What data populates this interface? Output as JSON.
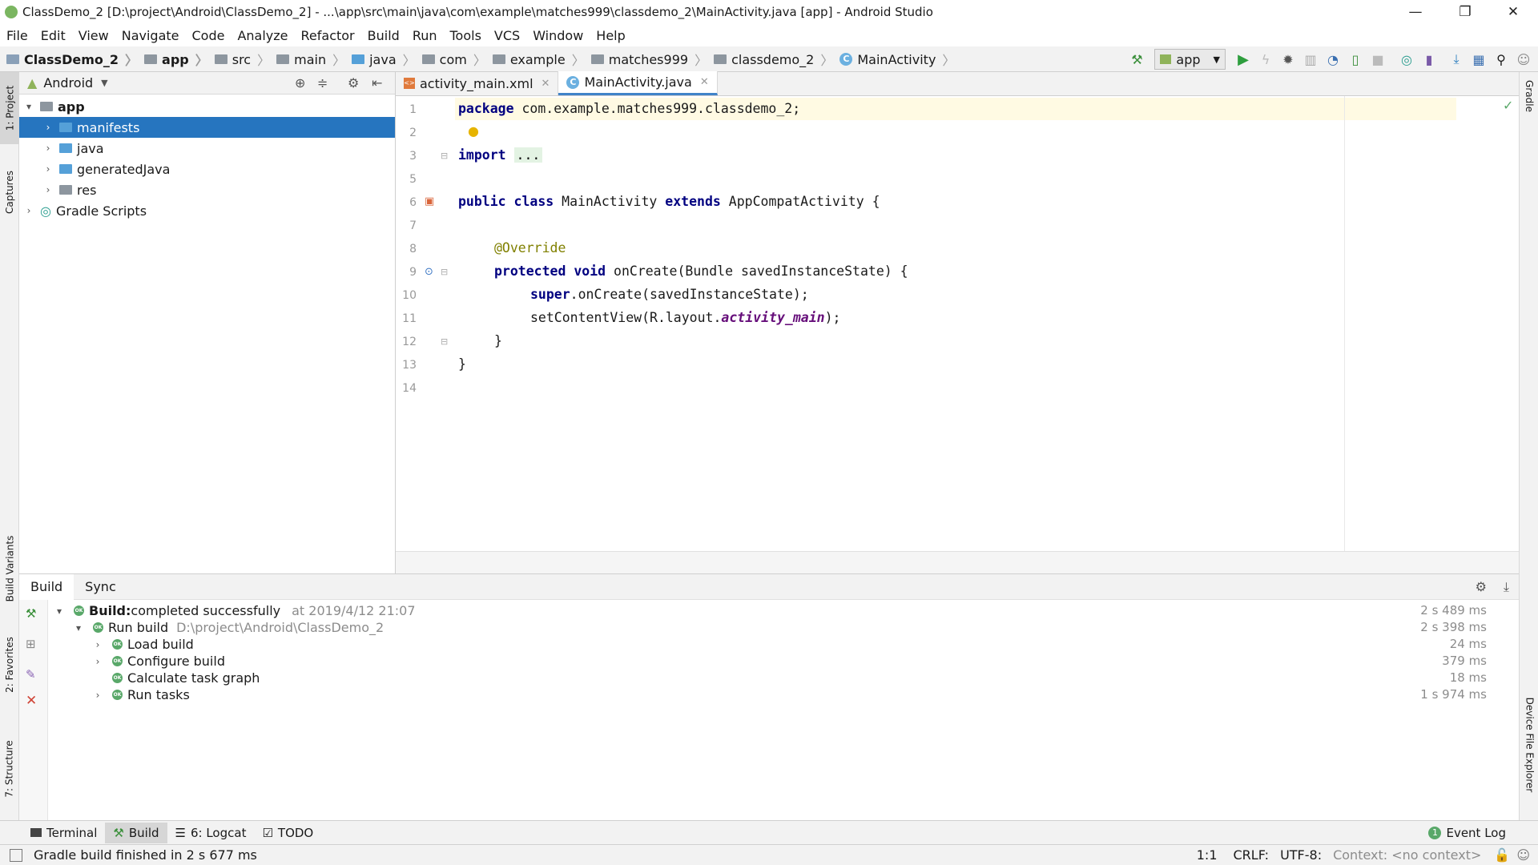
{
  "window": {
    "title": "ClassDemo_2 [D:\\project\\Android\\ClassDemo_2] - ...\\app\\src\\main\\java\\com\\example\\matches999\\classdemo_2\\MainActivity.java [app] - Android Studio",
    "minimize": "—",
    "restore": "❐",
    "close": "✕"
  },
  "menu": [
    "File",
    "Edit",
    "View",
    "Navigate",
    "Code",
    "Analyze",
    "Refactor",
    "Build",
    "Run",
    "Tools",
    "VCS",
    "Window",
    "Help"
  ],
  "breadcrumb": [
    "ClassDemo_2",
    "app",
    "src",
    "main",
    "java",
    "com",
    "example",
    "matches999",
    "classdemo_2",
    "MainActivity"
  ],
  "toolbar": {
    "run_config": "app",
    "icons": [
      "hammer-icon",
      "run-icon",
      "apply-changes-icon",
      "debug-icon",
      "coverage-icon",
      "profile-icon",
      "attach-debugger-icon",
      "stop-icon",
      "sync-gradle-icon",
      "avd-manager-icon",
      "sdk-manager-icon",
      "project-structure-icon",
      "search-icon",
      "account-icon"
    ]
  },
  "left_strip": {
    "project_tab": "1: Project",
    "captures_tab": "Captures",
    "build_variants_tab": "Build Variants",
    "favorites_tab": "2: Favorites",
    "structure_tab": "7: Structure"
  },
  "right_strip": {
    "gradle_tab": "Gradle",
    "device_explorer_tab": "Device File Explorer"
  },
  "project_panel": {
    "view_mode": "Android",
    "tree": [
      {
        "label": "app",
        "level": 0,
        "expanded": true,
        "bold": true
      },
      {
        "label": "manifests",
        "level": 1,
        "selected": true
      },
      {
        "label": "java",
        "level": 1
      },
      {
        "label": "generatedJava",
        "level": 1
      },
      {
        "label": "res",
        "level": 1
      },
      {
        "label": "Gradle Scripts",
        "level": 0
      }
    ]
  },
  "editor": {
    "tabs": [
      {
        "label": "activity_main.xml",
        "active": false
      },
      {
        "label": "MainActivity.java",
        "active": true
      }
    ],
    "line_numbers": [
      "1",
      "2",
      "3",
      "5",
      "6",
      "7",
      "8",
      "9",
      "10",
      "11",
      "12",
      "13",
      "14"
    ],
    "code": {
      "l1_kw": "package",
      "l1_rest": " com.example.matches999.classdemo_2;",
      "l3_kw": "import",
      "l3_fold": "...",
      "l6_kw1": "public class",
      "l6_name": " MainActivity ",
      "l6_kw2": "extends",
      "l6_rest": " AppCompatActivity {",
      "l8_ann": "@Override",
      "l9_kw": "protected void",
      "l9_rest": " onCreate(Bundle savedInstanceState) {",
      "l10_kw": "super",
      "l10_rest": ".onCreate(savedInstanceState);",
      "l11_a": "setContentView(R.layout.",
      "l11_it": "activity_main",
      "l11_b": ");",
      "l12": "}",
      "l13": "}"
    }
  },
  "build_panel": {
    "tabs": [
      "Build",
      "Sync"
    ],
    "rows": [
      {
        "label_bold": "Build:",
        "label": " completed successfully",
        "meta": "at 2019/4/12 21:07",
        "duration": "2 s 489 ms"
      },
      {
        "label": "Run build",
        "meta": "D:\\project\\Android\\ClassDemo_2",
        "duration": "2 s 398 ms"
      },
      {
        "label": "Load build",
        "duration": "24 ms"
      },
      {
        "label": "Configure build",
        "duration": "379 ms"
      },
      {
        "label": "Calculate task graph",
        "duration": "18 ms"
      },
      {
        "label": "Run tasks",
        "duration": "1 s 974 ms"
      }
    ]
  },
  "tool_buttons": {
    "terminal": "Terminal",
    "build": "Build",
    "logcat": "6: Logcat",
    "todo": "TODO",
    "event_log": "Event Log",
    "event_count": "1"
  },
  "status_bar": {
    "message": "Gradle build finished in 2 s 677 ms",
    "position": "1:1",
    "line_sep": "CRLF:",
    "encoding": "UTF-8:",
    "context": "Context: <no context>"
  },
  "colors": {
    "selection": "#2675bf",
    "keyword": "#000080",
    "annotation": "#808000",
    "ok_green": "#59a869"
  }
}
